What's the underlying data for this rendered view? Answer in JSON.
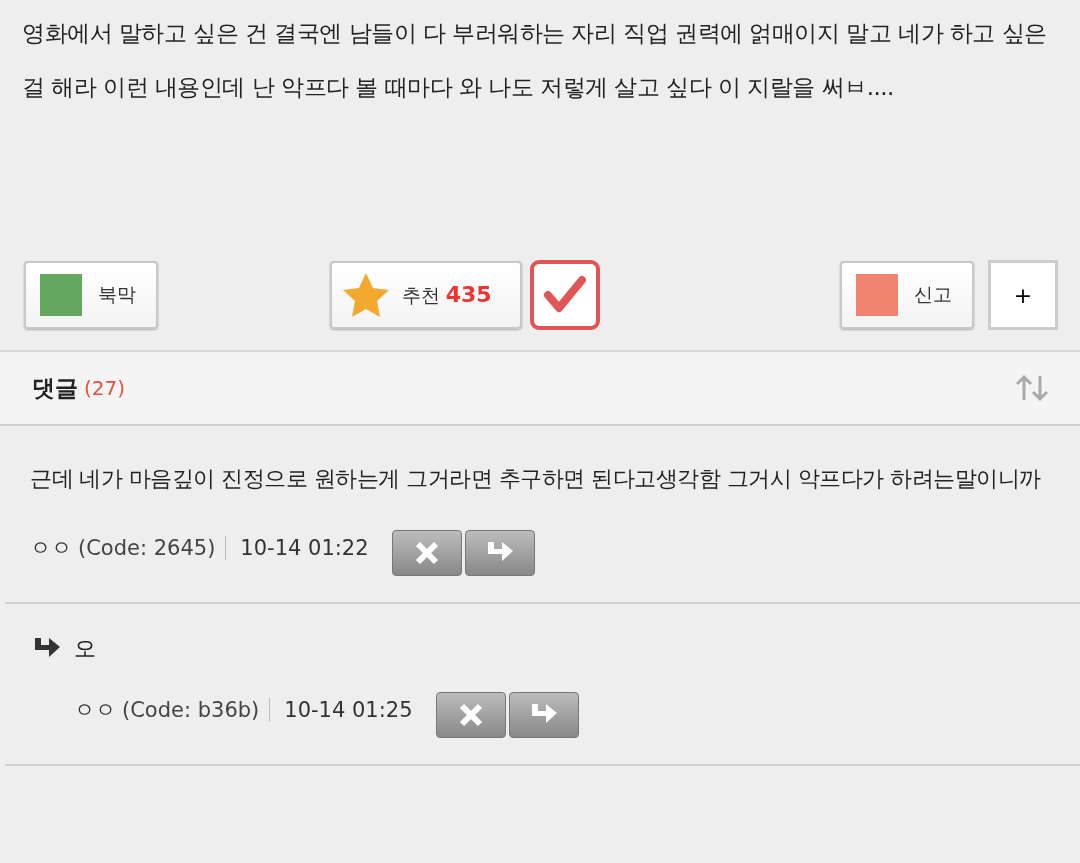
{
  "post": {
    "body": "영화에서 말하고 싶은 건 결국엔 남들이 다 부러워하는 자리 직업 권력에 얽매이지 말고 네가 하고 싶은 걸 해라 이런 내용인데 난 악프다 볼 때마다 와 나도 저렇게 살고 싶다 이 지랄을 써ㅂ...."
  },
  "actions": {
    "bookmark": {
      "label": "북막"
    },
    "recommend": {
      "label": "추천",
      "count": "435",
      "checked": true
    },
    "report": {
      "label": "신고"
    },
    "more": {
      "label": "+"
    }
  },
  "comments_header": {
    "title": "댓글",
    "count": "(27)"
  },
  "comments": [
    {
      "text": "근데 네가 마음깊이 진정으로 원하는게 그거라면 추구하면 된다고생각함 그거시 악프다가 하려는말이니까",
      "author": "ㅇㅇ",
      "code": "(Code: 2645)",
      "time": "10-14 01:22",
      "replies": [
        {
          "text": "오",
          "author": "ㅇㅇ",
          "code": "(Code: b36b)",
          "time": "10-14 01:25"
        }
      ]
    }
  ]
}
